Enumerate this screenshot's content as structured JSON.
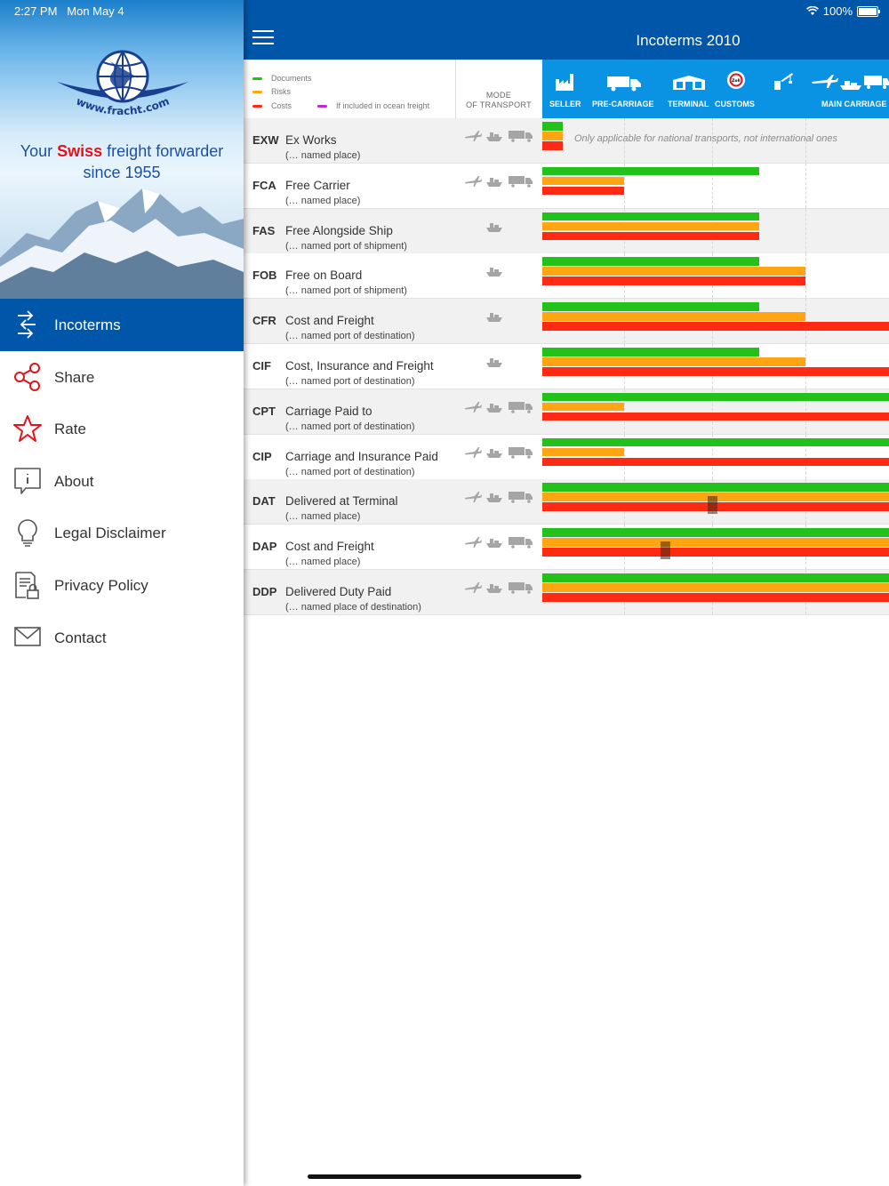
{
  "status": {
    "time": "2:27 PM",
    "date": "Mon May 4",
    "battery": "100%"
  },
  "header": {
    "title": "Incoterms 2010"
  },
  "legend": {
    "documents": "Documents",
    "risks": "Risks",
    "costs": "Costs",
    "ocean_note": "If included in ocean freight"
  },
  "mode_header": {
    "line1": "MODE",
    "line2": "OF TRANSPORT"
  },
  "phases": {
    "seller": "SELLER",
    "pre_carriage": "PRE-CARRIAGE",
    "terminal": "TERMINAL",
    "customs": "CUSTOMS",
    "main_carriage": "MAIN CARRIAGE",
    "customs_sign": "Zoll"
  },
  "colors": {
    "documents": "#22c21a",
    "risks": "#ffa514",
    "costs": "#ff2a14",
    "brand": "#0056a8",
    "phase_header": "#0a93e2",
    "ocean": "#b82cd6"
  },
  "exw_note": "Only applicable for national transports, not international ones",
  "terms": [
    {
      "code": "EXW",
      "name": "Ex Works",
      "place": "(… named place)",
      "modes": [
        "air",
        "sea",
        "road"
      ],
      "documents": 0.06,
      "risks": 0.06,
      "costs": 0.06
    },
    {
      "code": "FCA",
      "name": "Free Carrier",
      "place": "(… named place)",
      "modes": [
        "air",
        "sea",
        "road"
      ],
      "documents": 0.625,
      "risks": 0.235,
      "costs": 0.235
    },
    {
      "code": "FAS",
      "name": "Free Alongside Ship",
      "place": "(… named port of shipment)",
      "modes": [
        "sea"
      ],
      "documents": 0.625,
      "risks": 0.625,
      "costs": 0.625
    },
    {
      "code": "FOB",
      "name": "Free on Board",
      "place": "(… named port of shipment)",
      "modes": [
        "sea"
      ],
      "documents": 0.625,
      "risks": 0.76,
      "costs": 0.76
    },
    {
      "code": "CFR",
      "name": "Cost and Freight",
      "place": "(… named port of destination)",
      "modes": [
        "sea"
      ],
      "documents": 0.625,
      "risks": 0.76,
      "costs": 1.0
    },
    {
      "code": "CIF",
      "name": "Cost, Insurance and Freight",
      "place": "(… named port of destination)",
      "modes": [
        "sea"
      ],
      "documents": 0.625,
      "risks": 0.76,
      "costs": 1.0
    },
    {
      "code": "CPT",
      "name": "Carriage Paid to",
      "place": "(… named port of destination)",
      "modes": [
        "air",
        "sea",
        "road"
      ],
      "documents": 1.0,
      "risks": 0.235,
      "costs": 1.0
    },
    {
      "code": "CIP",
      "name": "Carriage and Insurance Paid",
      "place": "(… named port of destination)",
      "modes": [
        "air",
        "sea",
        "road"
      ],
      "documents": 1.0,
      "risks": 0.235,
      "costs": 1.0
    },
    {
      "code": "DAT",
      "name": "Delivered at Terminal",
      "place": "(… named place)",
      "modes": [
        "air",
        "sea",
        "road"
      ],
      "documents": 1.0,
      "risks": 1.0,
      "costs": 1.0,
      "marker": 0.49
    },
    {
      "code": "DAP",
      "name": "Cost and Freight",
      "place": "(… named place)",
      "modes": [
        "air",
        "sea",
        "road"
      ],
      "documents": 1.0,
      "risks": 1.0,
      "costs": 1.0,
      "marker": 0.355
    },
    {
      "code": "DDP",
      "name": "Delivered Duty Paid",
      "place": "(… named place of destination)",
      "modes": [
        "air",
        "sea",
        "road"
      ],
      "documents": 1.0,
      "risks": 1.0,
      "costs": 1.0
    }
  ],
  "sidebar": {
    "logo_url": "www.fracht.com",
    "tagline_pre": "Your ",
    "tagline_bold": "Swiss",
    "tagline_post": " freight forwarder",
    "tagline_line2": "since 1955",
    "items": [
      {
        "label": "Incoterms",
        "icon": "exchange-icon",
        "active": true
      },
      {
        "label": "Share",
        "icon": "share-icon"
      },
      {
        "label": "Rate",
        "icon": "star-icon"
      },
      {
        "label": "About",
        "icon": "info-icon"
      },
      {
        "label": "Legal Disclaimer",
        "icon": "lightbulb-icon"
      },
      {
        "label": "Privacy Policy",
        "icon": "document-lock-icon"
      },
      {
        "label": "Contact",
        "icon": "mail-icon"
      }
    ]
  }
}
